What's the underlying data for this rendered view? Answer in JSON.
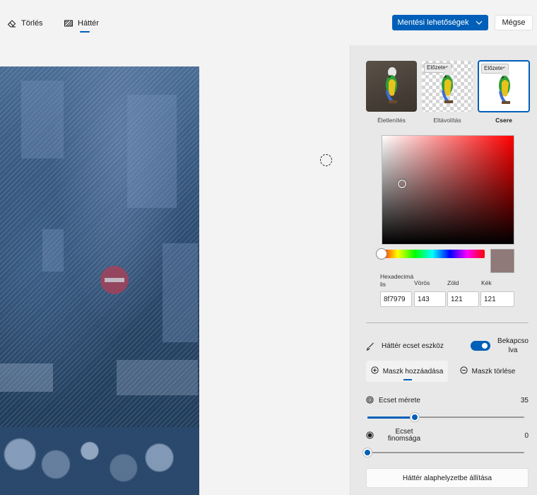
{
  "toolbar": {
    "delete_label": "Törlés",
    "background_label": "Háttér",
    "save_options_label": "Mentési lehetőségek",
    "cancel_label": "Mégse"
  },
  "thumbnails": [
    {
      "label": "Életlenítés",
      "badge": ""
    },
    {
      "label": "Eltávolítás",
      "badge": "Előzetes"
    },
    {
      "label": "Csere",
      "badge": "Előzetes",
      "selected": true
    }
  ],
  "color": {
    "selected_hex": "#8f7979",
    "hex_label": "Hexadecimá\nlis",
    "red_label": "Vörös",
    "green_label": "Zöld",
    "blue_label": "Kék",
    "hex_value": "8f7979",
    "red_value": "143",
    "green_value": "121",
    "blue_value": "121"
  },
  "brush": {
    "tool_label": "Háttér ecset eszköz",
    "toggle_state_label": "Bekapcso\nlva",
    "toggle_on": true,
    "add_mask_label": "Maszk hozzáadása",
    "remove_mask_label": "Maszk törlése",
    "size_label": "Ecset mérete",
    "size_value": "35",
    "size_fraction": 0.3,
    "softness_label": "Ecset\nfinomsága",
    "softness_value": "0",
    "softness_fraction": 0.0
  },
  "reset_label": "Háttér alaphelyzetbe állítása",
  "accent_color": "#005fb8"
}
